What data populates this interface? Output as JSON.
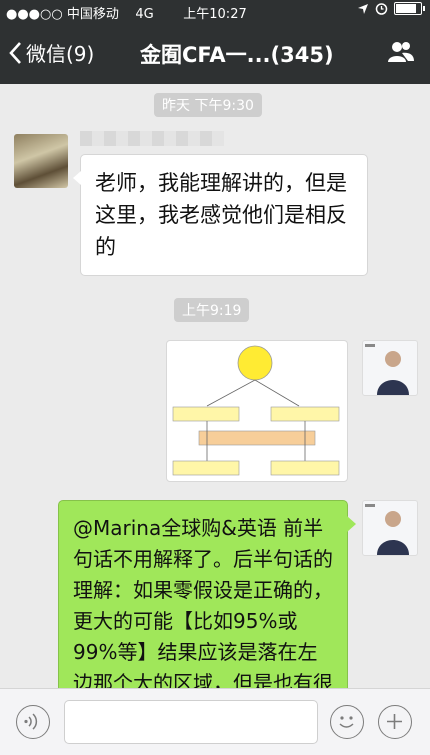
{
  "status_bar": {
    "signal": "●●●○○",
    "carrier": "中国移动",
    "network": "4G",
    "time": "上午10:27",
    "icons": [
      "location-arrow-icon",
      "alarm-icon",
      "battery-icon"
    ]
  },
  "nav": {
    "back_label": "微信(9)",
    "title": "金囿CFA一...(345)",
    "right_icon": "group-members-icon"
  },
  "messages": [
    {
      "type": "timestamp",
      "text": "昨天 下午9:30"
    },
    {
      "type": "text",
      "direction": "incoming",
      "sender_blurred": true,
      "text": "老师，我能理解讲的，但是这里，我老感觉他们是相反的"
    },
    {
      "type": "timestamp",
      "text": "上午9:19"
    },
    {
      "type": "image",
      "direction": "outgoing",
      "description_icon": "flowchart-image"
    },
    {
      "type": "text",
      "direction": "outgoing",
      "text": "@Marina全球购&英语 前半句话不用解释了。后半句话的理解：如果零假设是正确的，更大的可能【比如95%或99%等】结果应该是落在左边那个大的区域，但是也有很小的可能落在右边那个"
    }
  ],
  "input_bar": {
    "left_icon": "voice-icon",
    "right_icons": [
      "emoji-icon",
      "plus-icon"
    ]
  },
  "colors": {
    "nav_bg": "#2e3132",
    "chat_bg": "#ebebeb",
    "outgoing_bubble": "#a0e75a",
    "incoming_bubble": "#ffffff"
  }
}
